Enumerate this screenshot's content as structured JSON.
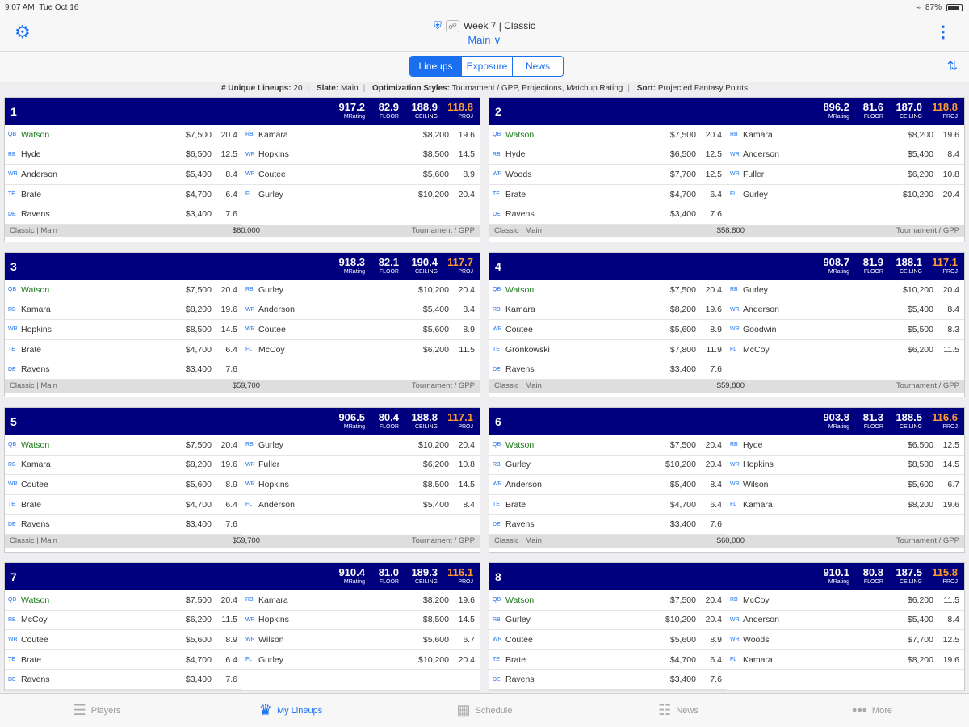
{
  "status": {
    "time": "9:07 AM",
    "date": "Tue Oct 16",
    "battery": "87%"
  },
  "nav": {
    "title": "Week 7 | Classic",
    "slate": "Main ∨"
  },
  "tabs": [
    "Lineups",
    "Exposure",
    "News"
  ],
  "summary": {
    "unique_label": "# Unique Lineups:",
    "unique_value": "20",
    "slate_label": "Slate:",
    "slate_value": "Main",
    "style_label": "Optimization Styles:",
    "style_value": "Tournament / GPP, Projections, Matchup Rating",
    "sort_label": "Sort:",
    "sort_value": "Projected Fantasy Points"
  },
  "stat_labels": {
    "mrating": "MRating",
    "floor": "FLOOR",
    "ceiling": "CEILING",
    "proj": "PROJ"
  },
  "lineups": [
    {
      "num": "1",
      "mrating": "917.2",
      "floor": "82.9",
      "ceiling": "188.9",
      "proj": "118.8",
      "salary": "$60,000",
      "footer_left": "Classic  |  Main",
      "footer_right": "Tournament / GPP",
      "left": [
        [
          "QB",
          "Watson",
          "$7,500",
          "20.4"
        ],
        [
          "RB",
          "Hyde",
          "$6,500",
          "12.5"
        ],
        [
          "WR",
          "Anderson",
          "$5,400",
          "8.4"
        ],
        [
          "TE",
          "Brate",
          "$4,700",
          "6.4"
        ],
        [
          "DE",
          "Ravens",
          "$3,400",
          "7.6"
        ]
      ],
      "right": [
        [
          "RB",
          "Kamara",
          "$8,200",
          "19.6"
        ],
        [
          "WR",
          "Hopkins",
          "$8,500",
          "14.5"
        ],
        [
          "WR",
          "Coutee",
          "$5,600",
          "8.9"
        ],
        [
          "FL",
          "Gurley",
          "$10,200",
          "20.4"
        ]
      ]
    },
    {
      "num": "2",
      "mrating": "896.2",
      "floor": "81.6",
      "ceiling": "187.0",
      "proj": "118.8",
      "salary": "$58,800",
      "footer_left": "Classic  |  Main",
      "footer_right": "Tournament / GPP",
      "left": [
        [
          "QB",
          "Watson",
          "$7,500",
          "20.4"
        ],
        [
          "RB",
          "Hyde",
          "$6,500",
          "12.5"
        ],
        [
          "WR",
          "Woods",
          "$7,700",
          "12.5"
        ],
        [
          "TE",
          "Brate",
          "$4,700",
          "6.4"
        ],
        [
          "DE",
          "Ravens",
          "$3,400",
          "7.6"
        ]
      ],
      "right": [
        [
          "RB",
          "Kamara",
          "$8,200",
          "19.6"
        ],
        [
          "WR",
          "Anderson",
          "$5,400",
          "8.4"
        ],
        [
          "WR",
          "Fuller",
          "$6,200",
          "10.8"
        ],
        [
          "FL",
          "Gurley",
          "$10,200",
          "20.4"
        ]
      ]
    },
    {
      "num": "3",
      "mrating": "918.3",
      "floor": "82.1",
      "ceiling": "190.4",
      "proj": "117.7",
      "salary": "$59,700",
      "footer_left": "Classic  |  Main",
      "footer_right": "Tournament / GPP",
      "left": [
        [
          "QB",
          "Watson",
          "$7,500",
          "20.4"
        ],
        [
          "RB",
          "Kamara",
          "$8,200",
          "19.6"
        ],
        [
          "WR",
          "Hopkins",
          "$8,500",
          "14.5"
        ],
        [
          "TE",
          "Brate",
          "$4,700",
          "6.4"
        ],
        [
          "DE",
          "Ravens",
          "$3,400",
          "7.6"
        ]
      ],
      "right": [
        [
          "RB",
          "Gurley",
          "$10,200",
          "20.4"
        ],
        [
          "WR",
          "Anderson",
          "$5,400",
          "8.4"
        ],
        [
          "WR",
          "Coutee",
          "$5,600",
          "8.9"
        ],
        [
          "FL",
          "McCoy",
          "$6,200",
          "11.5"
        ]
      ]
    },
    {
      "num": "4",
      "mrating": "908.7",
      "floor": "81.9",
      "ceiling": "188.1",
      "proj": "117.1",
      "salary": "$59,800",
      "footer_left": "Classic  |  Main",
      "footer_right": "Tournament / GPP",
      "left": [
        [
          "QB",
          "Watson",
          "$7,500",
          "20.4"
        ],
        [
          "RB",
          "Kamara",
          "$8,200",
          "19.6"
        ],
        [
          "WR",
          "Coutee",
          "$5,600",
          "8.9"
        ],
        [
          "TE",
          "Gronkowski",
          "$7,800",
          "11.9"
        ],
        [
          "DE",
          "Ravens",
          "$3,400",
          "7.6"
        ]
      ],
      "right": [
        [
          "RB",
          "Gurley",
          "$10,200",
          "20.4"
        ],
        [
          "WR",
          "Anderson",
          "$5,400",
          "8.4"
        ],
        [
          "WR",
          "Goodwin",
          "$5,500",
          "8.3"
        ],
        [
          "FL",
          "McCoy",
          "$6,200",
          "11.5"
        ]
      ]
    },
    {
      "num": "5",
      "mrating": "906.5",
      "floor": "80.4",
      "ceiling": "188.8",
      "proj": "117.1",
      "salary": "$59,700",
      "footer_left": "Classic  |  Main",
      "footer_right": "Tournament / GPP",
      "left": [
        [
          "QB",
          "Watson",
          "$7,500",
          "20.4"
        ],
        [
          "RB",
          "Kamara",
          "$8,200",
          "19.6"
        ],
        [
          "WR",
          "Coutee",
          "$5,600",
          "8.9"
        ],
        [
          "TE",
          "Brate",
          "$4,700",
          "6.4"
        ],
        [
          "DE",
          "Ravens",
          "$3,400",
          "7.6"
        ]
      ],
      "right": [
        [
          "RB",
          "Gurley",
          "$10,200",
          "20.4"
        ],
        [
          "WR",
          "Fuller",
          "$6,200",
          "10.8"
        ],
        [
          "WR",
          "Hopkins",
          "$8,500",
          "14.5"
        ],
        [
          "FL",
          "Anderson",
          "$5,400",
          "8.4"
        ]
      ]
    },
    {
      "num": "6",
      "mrating": "903.8",
      "floor": "81.3",
      "ceiling": "188.5",
      "proj": "116.6",
      "salary": "$60,000",
      "footer_left": "Classic  |  Main",
      "footer_right": "Tournament / GPP",
      "left": [
        [
          "QB",
          "Watson",
          "$7,500",
          "20.4"
        ],
        [
          "RB",
          "Gurley",
          "$10,200",
          "20.4"
        ],
        [
          "WR",
          "Anderson",
          "$5,400",
          "8.4"
        ],
        [
          "TE",
          "Brate",
          "$4,700",
          "6.4"
        ],
        [
          "DE",
          "Ravens",
          "$3,400",
          "7.6"
        ]
      ],
      "right": [
        [
          "RB",
          "Hyde",
          "$6,500",
          "12.5"
        ],
        [
          "WR",
          "Hopkins",
          "$8,500",
          "14.5"
        ],
        [
          "WR",
          "Wilson",
          "$5,600",
          "6.7"
        ],
        [
          "FL",
          "Kamara",
          "$8,200",
          "19.6"
        ]
      ]
    },
    {
      "num": "7",
      "mrating": "910.4",
      "floor": "81.0",
      "ceiling": "189.3",
      "proj": "116.1",
      "salary": "",
      "footer_left": "",
      "footer_right": "",
      "left": [
        [
          "QB",
          "Watson",
          "$7,500",
          "20.4"
        ],
        [
          "RB",
          "McCoy",
          "$6,200",
          "11.5"
        ],
        [
          "WR",
          "Coutee",
          "$5,600",
          "8.9"
        ],
        [
          "TE",
          "Brate",
          "$4,700",
          "6.4"
        ],
        [
          "DE",
          "Ravens",
          "$3,400",
          "7.6"
        ]
      ],
      "right": [
        [
          "RB",
          "Kamara",
          "$8,200",
          "19.6"
        ],
        [
          "WR",
          "Hopkins",
          "$8,500",
          "14.5"
        ],
        [
          "WR",
          "Wilson",
          "$5,600",
          "6.7"
        ],
        [
          "FL",
          "Gurley",
          "$10,200",
          "20.4"
        ]
      ]
    },
    {
      "num": "8",
      "mrating": "910.1",
      "floor": "80.8",
      "ceiling": "187.5",
      "proj": "115.8",
      "salary": "",
      "footer_left": "",
      "footer_right": "",
      "left": [
        [
          "QB",
          "Watson",
          "$7,500",
          "20.4"
        ],
        [
          "RB",
          "Gurley",
          "$10,200",
          "20.4"
        ],
        [
          "WR",
          "Coutee",
          "$5,600",
          "8.9"
        ],
        [
          "TE",
          "Brate",
          "$4,700",
          "6.4"
        ],
        [
          "DE",
          "Ravens",
          "$3,400",
          "7.6"
        ]
      ],
      "right": [
        [
          "RB",
          "McCoy",
          "$6,200",
          "11.5"
        ],
        [
          "WR",
          "Anderson",
          "$5,400",
          "8.4"
        ],
        [
          "WR",
          "Woods",
          "$7,700",
          "12.5"
        ],
        [
          "FL",
          "Kamara",
          "$8,200",
          "19.6"
        ]
      ]
    }
  ],
  "tabbar": [
    {
      "label": "Players",
      "icon": "list-icon"
    },
    {
      "label": "My Lineups",
      "icon": "crown-icon",
      "active": true
    },
    {
      "label": "Schedule",
      "icon": "calendar-icon"
    },
    {
      "label": "News",
      "icon": "newspaper-icon"
    },
    {
      "label": "More",
      "icon": "more-icon"
    }
  ]
}
